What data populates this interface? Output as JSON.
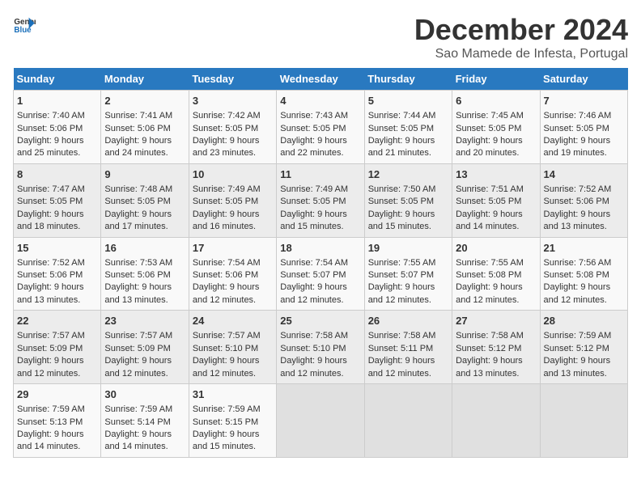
{
  "header": {
    "logo_general": "General",
    "logo_blue": "Blue",
    "title": "December 2024",
    "subtitle": "Sao Mamede de Infesta, Portugal"
  },
  "days_of_week": [
    "Sunday",
    "Monday",
    "Tuesday",
    "Wednesday",
    "Thursday",
    "Friday",
    "Saturday"
  ],
  "weeks": [
    [
      {
        "day": "1",
        "lines": [
          "Sunrise: 7:40 AM",
          "Sunset: 5:06 PM",
          "Daylight: 9 hours",
          "and 25 minutes."
        ]
      },
      {
        "day": "2",
        "lines": [
          "Sunrise: 7:41 AM",
          "Sunset: 5:06 PM",
          "Daylight: 9 hours",
          "and 24 minutes."
        ]
      },
      {
        "day": "3",
        "lines": [
          "Sunrise: 7:42 AM",
          "Sunset: 5:05 PM",
          "Daylight: 9 hours",
          "and 23 minutes."
        ]
      },
      {
        "day": "4",
        "lines": [
          "Sunrise: 7:43 AM",
          "Sunset: 5:05 PM",
          "Daylight: 9 hours",
          "and 22 minutes."
        ]
      },
      {
        "day": "5",
        "lines": [
          "Sunrise: 7:44 AM",
          "Sunset: 5:05 PM",
          "Daylight: 9 hours",
          "and 21 minutes."
        ]
      },
      {
        "day": "6",
        "lines": [
          "Sunrise: 7:45 AM",
          "Sunset: 5:05 PM",
          "Daylight: 9 hours",
          "and 20 minutes."
        ]
      },
      {
        "day": "7",
        "lines": [
          "Sunrise: 7:46 AM",
          "Sunset: 5:05 PM",
          "Daylight: 9 hours",
          "and 19 minutes."
        ]
      }
    ],
    [
      {
        "day": "8",
        "lines": [
          "Sunrise: 7:47 AM",
          "Sunset: 5:05 PM",
          "Daylight: 9 hours",
          "and 18 minutes."
        ]
      },
      {
        "day": "9",
        "lines": [
          "Sunrise: 7:48 AM",
          "Sunset: 5:05 PM",
          "Daylight: 9 hours",
          "and 17 minutes."
        ]
      },
      {
        "day": "10",
        "lines": [
          "Sunrise: 7:49 AM",
          "Sunset: 5:05 PM",
          "Daylight: 9 hours",
          "and 16 minutes."
        ]
      },
      {
        "day": "11",
        "lines": [
          "Sunrise: 7:49 AM",
          "Sunset: 5:05 PM",
          "Daylight: 9 hours",
          "and 15 minutes."
        ]
      },
      {
        "day": "12",
        "lines": [
          "Sunrise: 7:50 AM",
          "Sunset: 5:05 PM",
          "Daylight: 9 hours",
          "and 15 minutes."
        ]
      },
      {
        "day": "13",
        "lines": [
          "Sunrise: 7:51 AM",
          "Sunset: 5:05 PM",
          "Daylight: 9 hours",
          "and 14 minutes."
        ]
      },
      {
        "day": "14",
        "lines": [
          "Sunrise: 7:52 AM",
          "Sunset: 5:06 PM",
          "Daylight: 9 hours",
          "and 13 minutes."
        ]
      }
    ],
    [
      {
        "day": "15",
        "lines": [
          "Sunrise: 7:52 AM",
          "Sunset: 5:06 PM",
          "Daylight: 9 hours",
          "and 13 minutes."
        ]
      },
      {
        "day": "16",
        "lines": [
          "Sunrise: 7:53 AM",
          "Sunset: 5:06 PM",
          "Daylight: 9 hours",
          "and 13 minutes."
        ]
      },
      {
        "day": "17",
        "lines": [
          "Sunrise: 7:54 AM",
          "Sunset: 5:06 PM",
          "Daylight: 9 hours",
          "and 12 minutes."
        ]
      },
      {
        "day": "18",
        "lines": [
          "Sunrise: 7:54 AM",
          "Sunset: 5:07 PM",
          "Daylight: 9 hours",
          "and 12 minutes."
        ]
      },
      {
        "day": "19",
        "lines": [
          "Sunrise: 7:55 AM",
          "Sunset: 5:07 PM",
          "Daylight: 9 hours",
          "and 12 minutes."
        ]
      },
      {
        "day": "20",
        "lines": [
          "Sunrise: 7:55 AM",
          "Sunset: 5:08 PM",
          "Daylight: 9 hours",
          "and 12 minutes."
        ]
      },
      {
        "day": "21",
        "lines": [
          "Sunrise: 7:56 AM",
          "Sunset: 5:08 PM",
          "Daylight: 9 hours",
          "and 12 minutes."
        ]
      }
    ],
    [
      {
        "day": "22",
        "lines": [
          "Sunrise: 7:57 AM",
          "Sunset: 5:09 PM",
          "Daylight: 9 hours",
          "and 12 minutes."
        ]
      },
      {
        "day": "23",
        "lines": [
          "Sunrise: 7:57 AM",
          "Sunset: 5:09 PM",
          "Daylight: 9 hours",
          "and 12 minutes."
        ]
      },
      {
        "day": "24",
        "lines": [
          "Sunrise: 7:57 AM",
          "Sunset: 5:10 PM",
          "Daylight: 9 hours",
          "and 12 minutes."
        ]
      },
      {
        "day": "25",
        "lines": [
          "Sunrise: 7:58 AM",
          "Sunset: 5:10 PM",
          "Daylight: 9 hours",
          "and 12 minutes."
        ]
      },
      {
        "day": "26",
        "lines": [
          "Sunrise: 7:58 AM",
          "Sunset: 5:11 PM",
          "Daylight: 9 hours",
          "and 12 minutes."
        ]
      },
      {
        "day": "27",
        "lines": [
          "Sunrise: 7:58 AM",
          "Sunset: 5:12 PM",
          "Daylight: 9 hours",
          "and 13 minutes."
        ]
      },
      {
        "day": "28",
        "lines": [
          "Sunrise: 7:59 AM",
          "Sunset: 5:12 PM",
          "Daylight: 9 hours",
          "and 13 minutes."
        ]
      }
    ],
    [
      {
        "day": "29",
        "lines": [
          "Sunrise: 7:59 AM",
          "Sunset: 5:13 PM",
          "Daylight: 9 hours",
          "and 14 minutes."
        ]
      },
      {
        "day": "30",
        "lines": [
          "Sunrise: 7:59 AM",
          "Sunset: 5:14 PM",
          "Daylight: 9 hours",
          "and 14 minutes."
        ]
      },
      {
        "day": "31",
        "lines": [
          "Sunrise: 7:59 AM",
          "Sunset: 5:15 PM",
          "Daylight: 9 hours",
          "and 15 minutes."
        ]
      },
      {
        "day": "",
        "lines": []
      },
      {
        "day": "",
        "lines": []
      },
      {
        "day": "",
        "lines": []
      },
      {
        "day": "",
        "lines": []
      }
    ]
  ]
}
